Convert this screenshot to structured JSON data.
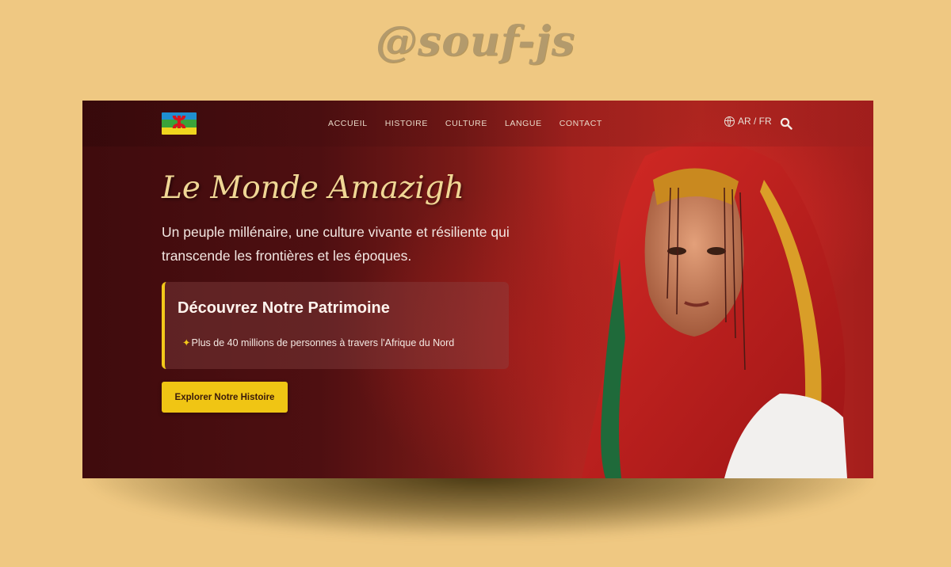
{
  "watermark": "@souf-js",
  "header": {
    "logo_symbol": "ⵣ",
    "nav": [
      "ACCUEIL",
      "HISTOIRE",
      "CULTURE",
      "LANGUE",
      "CONTACT"
    ],
    "lang_switch": "AR / FR"
  },
  "hero": {
    "title": "Le Monde Amazigh",
    "subtitle": "Un peuple millénaire, une culture vivante et résiliente qui transcende les frontières et les époques.",
    "card": {
      "title": "Découvrez Notre Patrimoine",
      "fact_icon": "✦",
      "fact": "Plus de 40 millions de personnes à travers l'Afrique du Nord"
    },
    "cta_label": "Explorer Notre Histoire"
  },
  "colors": {
    "accent": "#f0c514",
    "hero_dark": "#3f0b0d",
    "hero_red": "#c22a22",
    "title_gold": "#f0d795",
    "page_bg": "#efc882"
  },
  "icons": {
    "lang": "globe-icon",
    "search": "search-icon",
    "fact": "sparkle-icon"
  }
}
